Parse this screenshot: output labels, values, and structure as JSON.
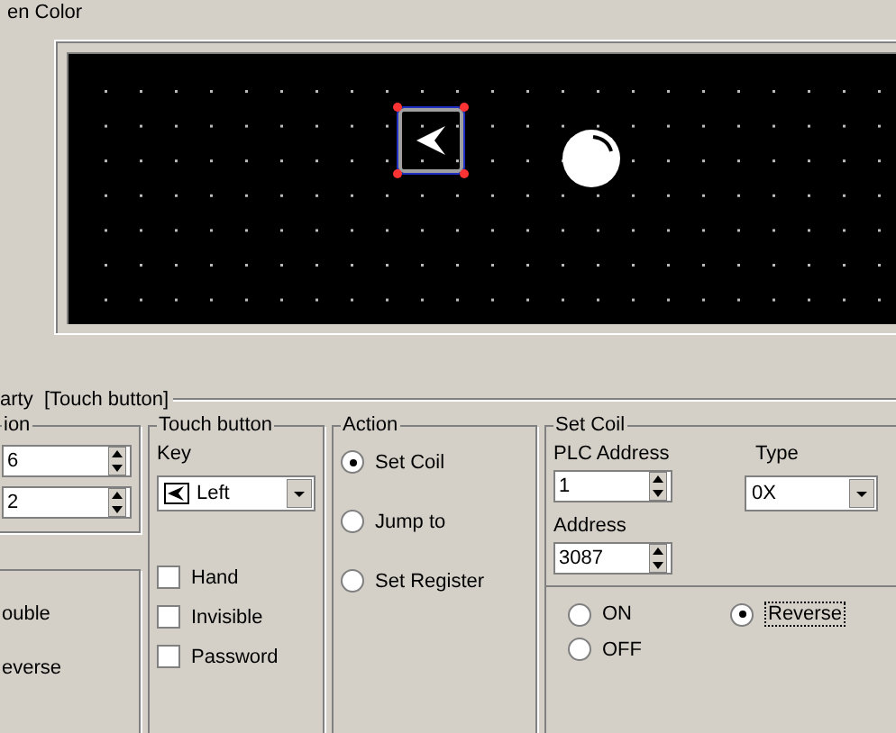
{
  "screen_group": {
    "title": "en Color"
  },
  "canvas": {
    "touch_button": {
      "selected": true
    }
  },
  "property": {
    "title": "arty  [Touch button]"
  },
  "position": {
    "title": "ion",
    "values": [
      "6",
      "2"
    ]
  },
  "style_group": {
    "options": [
      "ouble",
      "everse"
    ]
  },
  "touch_button": {
    "title": "Touch button",
    "key_label": "Key",
    "key_value": "Left",
    "options": [
      {
        "label": "Hand",
        "checked": false
      },
      {
        "label": "Invisible",
        "checked": false
      },
      {
        "label": "Password",
        "checked": false
      }
    ]
  },
  "action": {
    "title": "Action",
    "options": [
      {
        "label": "Set Coil",
        "selected": true
      },
      {
        "label": "Jump to",
        "selected": false
      },
      {
        "label": "Set Register",
        "selected": false
      }
    ]
  },
  "set_coil": {
    "title": "Set Coil",
    "plc_label": "PLC Address",
    "plc_value": "1",
    "type_label": "Type",
    "type_value": "0X",
    "address_label": "Address",
    "address_value": "3087",
    "options": [
      {
        "label": "ON",
        "selected": false
      },
      {
        "label": "OFF",
        "selected": false
      },
      {
        "label": "Reverse",
        "selected": true
      }
    ]
  }
}
